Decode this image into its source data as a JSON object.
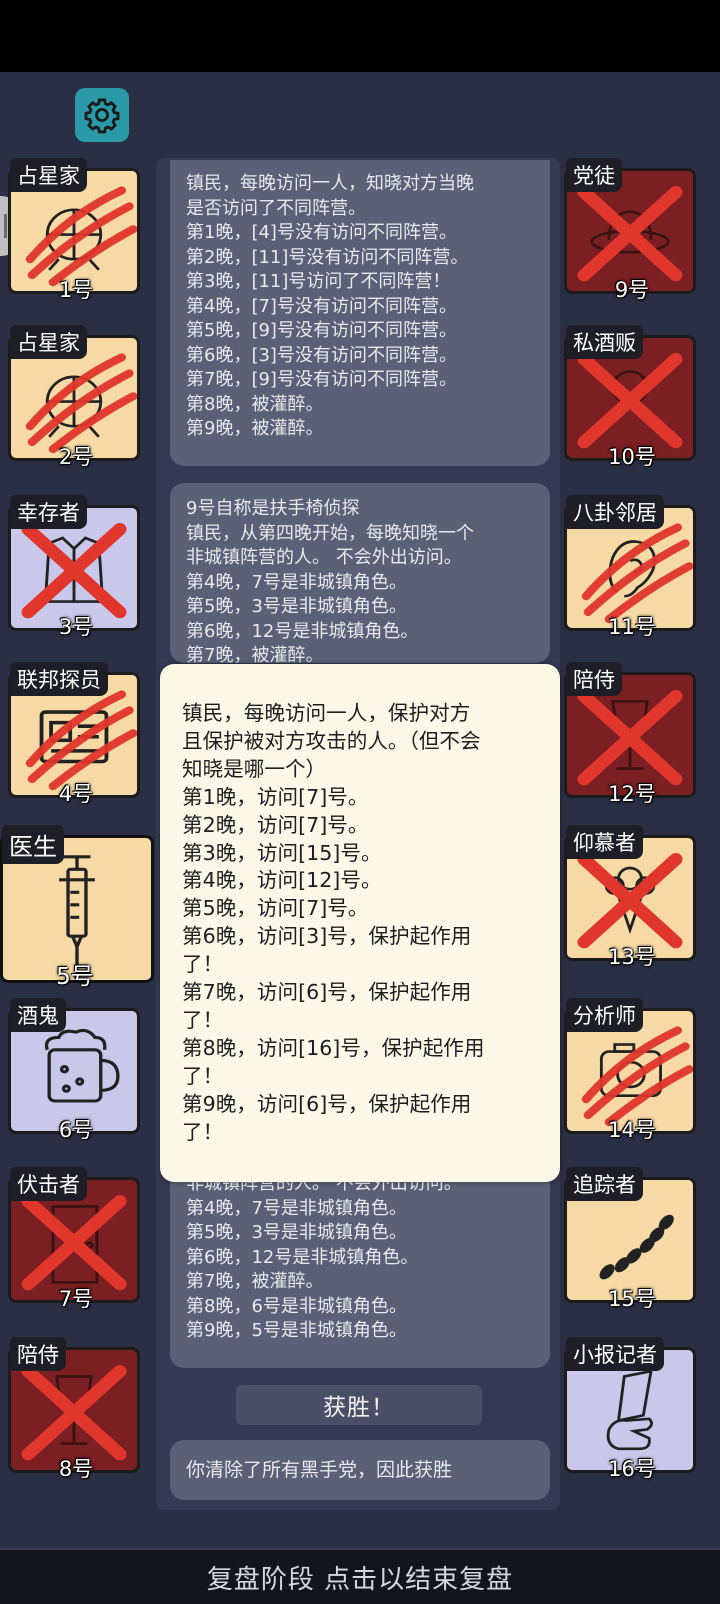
{
  "colors": {
    "background": "#2b2f45",
    "town_card": "#f6d9a4",
    "evil_card": "#7b1f22",
    "neutral_card": "#c9c8ea",
    "cross": "#e0362c"
  },
  "settings": {
    "icon": "gear-icon"
  },
  "players": [
    {
      "num": "1号",
      "role": "占星家",
      "card": "town",
      "status": "claw",
      "icon": "astrolabe-icon"
    },
    {
      "num": "2号",
      "role": "占星家",
      "card": "town",
      "status": "claw",
      "icon": "astrolabe-icon"
    },
    {
      "num": "3号",
      "role": "幸存者",
      "card": "neutral",
      "status": "cross",
      "icon": "vest-icon"
    },
    {
      "num": "4号",
      "role": "联邦探员",
      "card": "town",
      "status": "claw",
      "icon": "badge-icon"
    },
    {
      "num": "5号",
      "role": "医生",
      "card": "town",
      "status": "selected",
      "icon": "syringe-icon"
    },
    {
      "num": "6号",
      "role": "酒鬼",
      "card": "neutral",
      "status": "none",
      "icon": "beer-mug-icon"
    },
    {
      "num": "7号",
      "role": "伏击者",
      "card": "evil",
      "status": "cross",
      "icon": "door-icon"
    },
    {
      "num": "8号",
      "role": "陪侍",
      "card": "evil",
      "status": "cross",
      "icon": "wine-glass-icon"
    },
    {
      "num": "9号",
      "role": "党徒",
      "card": "evil",
      "status": "cross",
      "icon": "hat-icon"
    },
    {
      "num": "10号",
      "role": "私酒贩",
      "card": "evil",
      "status": "cross",
      "icon": "bootlegger-icon"
    },
    {
      "num": "11号",
      "role": "八卦邻居",
      "card": "town",
      "status": "claw",
      "icon": "ear-icon"
    },
    {
      "num": "12号",
      "role": "陪侍",
      "card": "evil",
      "status": "cross",
      "icon": "wine-glass-icon"
    },
    {
      "num": "13号",
      "role": "仰慕者",
      "card": "town",
      "status": "cross",
      "icon": "bouquet-icon"
    },
    {
      "num": "14号",
      "role": "分析师",
      "card": "town",
      "status": "claw",
      "icon": "camera-icon"
    },
    {
      "num": "15号",
      "role": "追踪者",
      "card": "town",
      "status": "none",
      "icon": "footprints-icon"
    },
    {
      "num": "16号",
      "role": "小报记者",
      "card": "neutral",
      "status": "none",
      "icon": "newspaper-hand-icon"
    }
  ],
  "log_cards": [
    {
      "lines": [
        "镇民，每晚访问一人，知晓对方当晚",
        "是否访问了不同阵营。",
        "第1晚，[4]号没有访问不同阵营。",
        "第2晚，[11]号没有访问不同阵营。",
        "第3晚，[11]号访问了不同阵营！",
        "第4晚，[7]号没有访问不同阵营。",
        "第5晚，[9]号没有访问不同阵营。",
        "第6晚，[3]号没有访问不同阵营。",
        "第7晚，[9]号没有访问不同阵营。",
        "第8晚，被灌醉。",
        "第9晚，被灌醉。"
      ]
    },
    {
      "lines": [
        "9号自称是扶手椅侦探",
        "镇民，从第四晚开始，每晚知晓一个",
        "非城镇阵营的人。 不会外出访问。",
        "第4晚，7号是非城镇角色。",
        "第5晚，3号是非城镇角色。",
        "第6晚，12号是非城镇角色。",
        "第7晚，被灌醉。"
      ]
    },
    {
      "lines": [
        "非城镇阵营的人。 不会外出访问。",
        "第4晚，7号是非城镇角色。",
        "第5晚，3号是非城镇角色。",
        "第6晚，12号是非城镇角色。",
        "第7晚，被灌醉。",
        "第8晚，6号是非城镇角色。",
        "第9晚，5号是非城镇角色。"
      ]
    }
  ],
  "victory_label": "获胜！",
  "result_text": "你清除了所有黑手党，因此获胜",
  "popup": {
    "lines": [
      "镇民，每晚访问一人，保护对方",
      "且保护被对方攻击的人。（但不会",
      "知晓是哪一个）",
      "第1晚，访问[7]号。",
      "第2晚，访问[7]号。",
      "第3晚，访问[15]号。",
      "第4晚，访问[12]号。",
      "第5晚，访问[7]号。",
      "第6晚，访问[3]号，保护起作用",
      "了！",
      "第7晚，访问[6]号，保护起作用",
      "了！",
      "第8晚，访问[16]号，保护起作用",
      "了！",
      "第9晚，访问[6]号，保护起作用",
      "了！"
    ]
  },
  "bottom_bar": "复盘阶段 点击以结束复盘"
}
